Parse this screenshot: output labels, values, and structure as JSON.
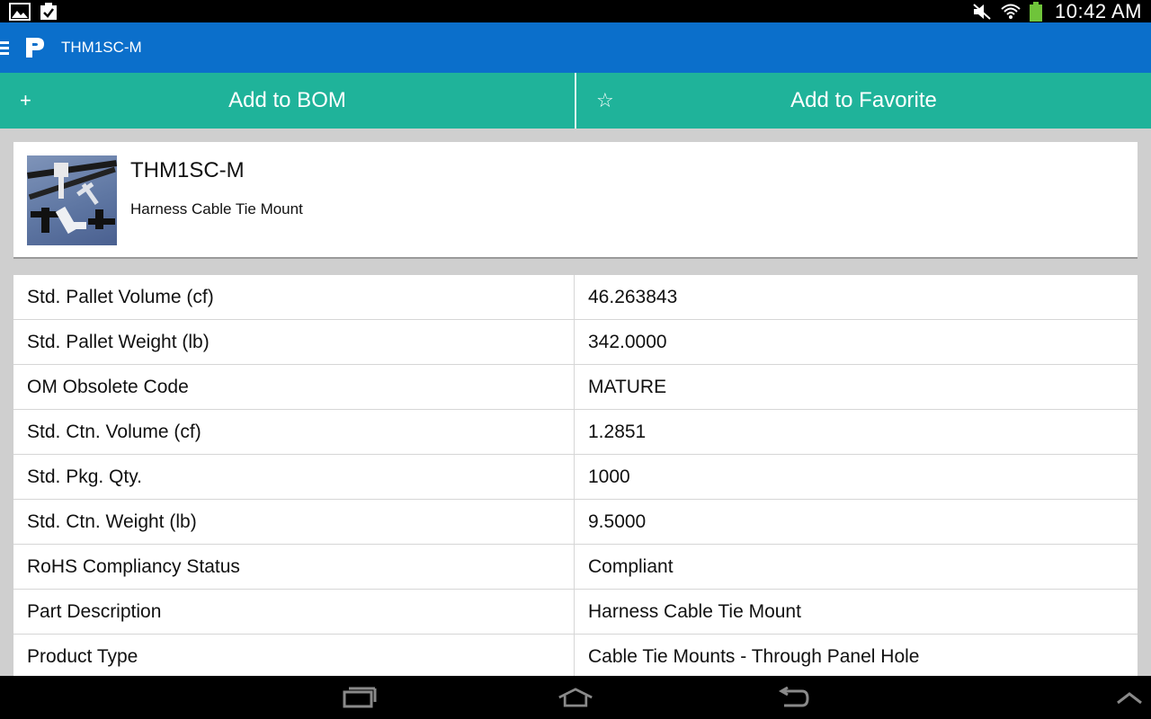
{
  "status_bar": {
    "time": "10:42 AM",
    "icons_left": [
      "gallery-icon",
      "clipboard-check-icon"
    ],
    "icons_right": [
      "mute-icon",
      "wifi-icon",
      "battery-icon"
    ]
  },
  "app_bar": {
    "logo": "P",
    "title": "THM1SC-M",
    "color": "#0b6fcb"
  },
  "actions": {
    "add_bom_label": "Add to BOM",
    "add_bom_icon": "+",
    "add_favorite_label": "Add to Favorite",
    "add_favorite_icon": "☆",
    "color": "#1fb39a"
  },
  "product": {
    "part_number": "THM1SC-M",
    "name": "Harness Cable Tie Mount"
  },
  "specs": [
    {
      "label": "Std. Pallet Volume (cf)",
      "value": "46.263843"
    },
    {
      "label": "Std. Pallet Weight (lb)",
      "value": "342.0000"
    },
    {
      "label": "OM Obsolete Code",
      "value": "MATURE"
    },
    {
      "label": "Std. Ctn. Volume (cf)",
      "value": "1.2851"
    },
    {
      "label": "Std. Pkg. Qty.",
      "value": "1000"
    },
    {
      "label": "Std. Ctn. Weight (lb)",
      "value": "9.5000"
    },
    {
      "label": "RoHS Compliancy Status",
      "value": "Compliant"
    },
    {
      "label": "Part Description",
      "value": "Harness Cable Tie Mount"
    },
    {
      "label": "Product Type",
      "value": "Cable Tie Mounts - Through Panel Hole"
    }
  ],
  "nav_bar": {
    "buttons": [
      "recent-apps-icon",
      "home-icon",
      "back-icon",
      "chevron-up-icon"
    ]
  }
}
